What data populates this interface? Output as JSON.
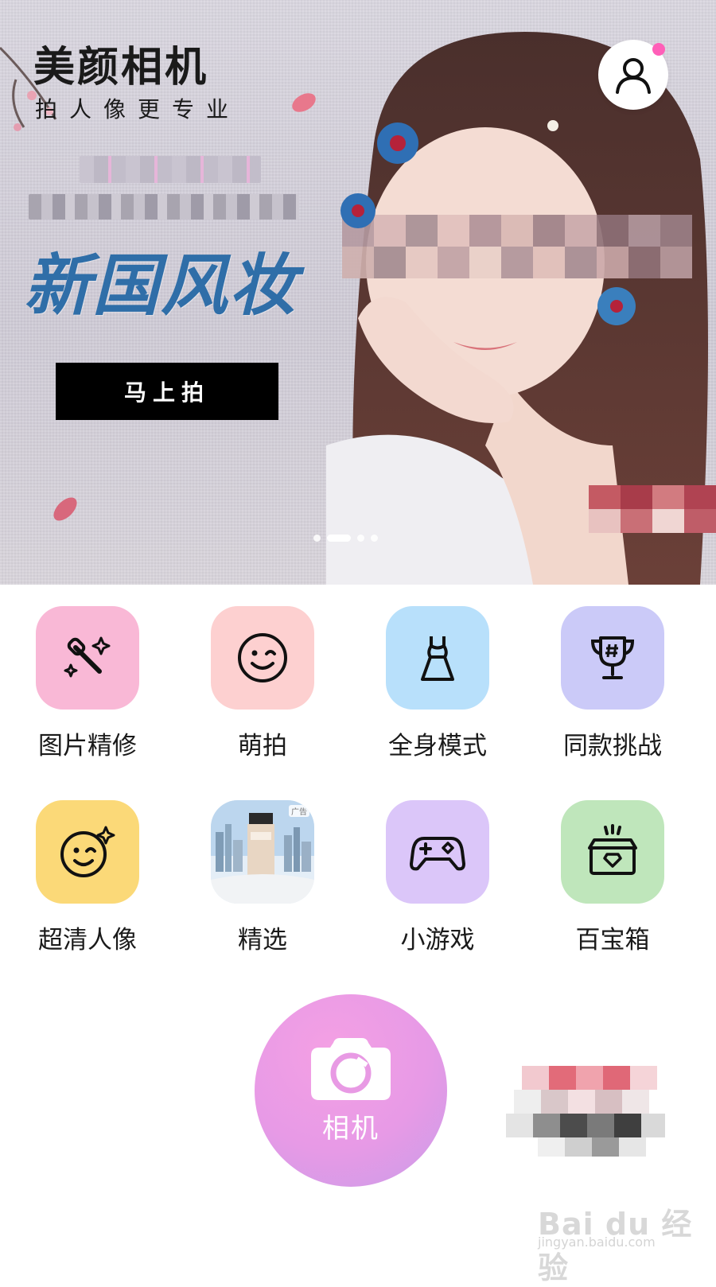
{
  "app": {
    "title": "美颜相机",
    "slogan": "拍人像更专业"
  },
  "banner": {
    "campaign_title": "新国风妆",
    "cta_label": "马上拍",
    "carousel_total": 4,
    "carousel_active_index": 1
  },
  "header": {
    "profile_icon": "user-icon",
    "has_notification": true
  },
  "tools": {
    "row1": [
      {
        "label": "图片精修",
        "icon": "makeup-brush-icon",
        "color": "#f9b8d6"
      },
      {
        "label": "萌拍",
        "icon": "wink-face-icon",
        "color": "#fdd0d0"
      },
      {
        "label": "全身模式",
        "icon": "dress-icon",
        "color": "#b8e0fb"
      },
      {
        "label": "同款挑战",
        "icon": "trophy-icon",
        "color": "#cbcaf8"
      }
    ],
    "row2": [
      {
        "label": "超清人像",
        "icon": "sparkle-face-icon",
        "color": "#fbd978"
      },
      {
        "label": "精选",
        "icon": "ad-image",
        "color": "#d9e6f3",
        "ad_tag": "广告"
      },
      {
        "label": "小游戏",
        "icon": "gamepad-icon",
        "color": "#dbc6f9"
      },
      {
        "label": "百宝箱",
        "icon": "treasure-box-icon",
        "color": "#bfe6bb"
      }
    ]
  },
  "camera": {
    "label": "相机",
    "icon": "camera-icon"
  },
  "watermark": {
    "text": "Bai du 经验",
    "url": "jingyan.baidu.com"
  }
}
